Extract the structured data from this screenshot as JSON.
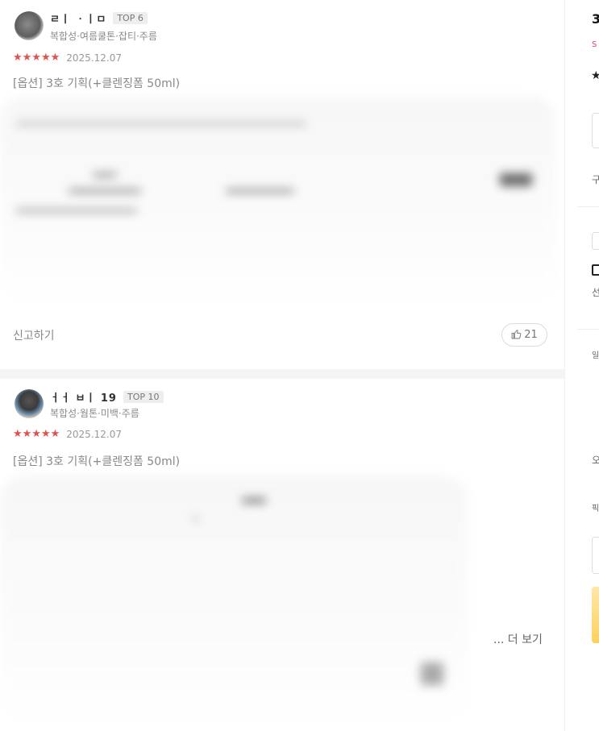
{
  "reviews": [
    {
      "nickname": "ㄹㅣ ㆍㅣㅁ",
      "rank": "TOP 6",
      "skin_tags": "복합성·여름쿨톤·잡티·주름",
      "stars": "★★★★★",
      "date": "2025.12.07",
      "option": "[옵션] 3호 기획(+클렌징폼 50ml)",
      "report_label": "신고하기",
      "like_count": "21"
    },
    {
      "nickname": "ㅓㅓ ㅂㅣ 19",
      "rank": "TOP 10",
      "skin_tags": "복합성·웜톤·미백·주름",
      "stars": "★★★★★",
      "date": "2025.12.07",
      "option": "[옵션] 3호 기획(+클렌징폼 50ml)",
      "more_label": "... 더 보기"
    }
  ],
  "right_panel": {
    "title_fragment": "3",
    "sale_fragment": "S",
    "star": "★",
    "text_1": "구",
    "text_2": "선",
    "text_3": "일",
    "text_4": "오",
    "text_5": "픽"
  },
  "colors": {
    "star": "#e0524f",
    "badge_bg": "#eeeeee",
    "cta": "#ffd15c"
  },
  "icons": [
    "thumbs-up-icon",
    "shopping-bag-icon",
    "star-icon"
  ]
}
